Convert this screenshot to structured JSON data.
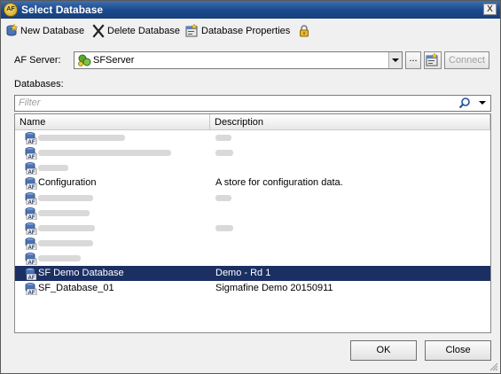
{
  "window": {
    "title": "Select Database",
    "close_label": "X"
  },
  "toolbar": {
    "new_database": "New Database",
    "delete_database": "Delete Database",
    "database_properties": "Database Properties"
  },
  "server": {
    "label": "AF Server:",
    "value": "SFServer",
    "browse_label": "...",
    "connect_label": "Connect"
  },
  "databases": {
    "label": "Databases:",
    "filter_placeholder": "Filter",
    "columns": [
      "Name",
      "Description"
    ],
    "rows": [
      {
        "name": "",
        "description": "",
        "blurred": true
      },
      {
        "name": "",
        "description": "",
        "blurred": true
      },
      {
        "name": "",
        "description": "",
        "blurred": true
      },
      {
        "name": "Configuration",
        "description": "A store for configuration data.",
        "blurred": false
      },
      {
        "name": "",
        "description": "",
        "blurred": true
      },
      {
        "name": "",
        "description": "",
        "blurred": true
      },
      {
        "name": "",
        "description": "",
        "blurred": true
      },
      {
        "name": "",
        "description": "",
        "blurred": true
      },
      {
        "name": "",
        "description": "",
        "blurred": true
      },
      {
        "name": "SF Demo Database",
        "description": "Demo - Rd 1",
        "blurred": false,
        "selected": true
      },
      {
        "name": "SF_Database_01",
        "description": "Sigmafine Demo 20150911",
        "blurred": false
      }
    ]
  },
  "footer": {
    "ok_label": "OK",
    "close_label": "Close"
  },
  "app_icon_text": "AF",
  "colors": {
    "titlebar": "#1d4a8c",
    "selection": "#1b2f63",
    "window_bg": "#f0f0f0"
  }
}
